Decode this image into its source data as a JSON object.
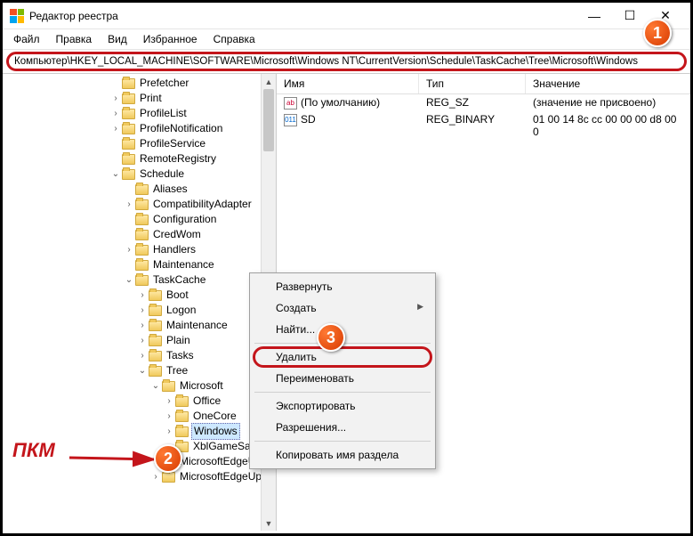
{
  "title": "Редактор реестра",
  "menu": {
    "file": "Файл",
    "edit": "Правка",
    "view": "Вид",
    "fav": "Избранное",
    "help": "Справка"
  },
  "address": "Компьютер\\HKEY_LOCAL_MACHINE\\SOFTWARE\\Microsoft\\Windows NT\\CurrentVersion\\Schedule\\TaskCache\\Tree\\Microsoft\\Windows",
  "tree": {
    "n0": "Prefetcher",
    "n1": "Print",
    "n2": "ProfileList",
    "n3": "ProfileNotification",
    "n4": "ProfileService",
    "n5": "RemoteRegistry",
    "schedule": "Schedule",
    "n6": "Aliases",
    "n7": "CompatibilityAdapter",
    "n8": "Configuration",
    "n9": "CredWom",
    "n10": "Handlers",
    "n11": "Maintenance",
    "taskcache": "TaskCache",
    "n12": "Boot",
    "n13": "Logon",
    "n14": "Maintenance",
    "n15": "Plain",
    "n16": "Tasks",
    "treek": "Tree",
    "ms": "Microsoft",
    "n17": "Office",
    "n18": "OneCore",
    "win": "Windows",
    "n19": "XblGameSave",
    "n20": "MicrosoftEdgeUp",
    "n21": "MicrosoftEdgeUp"
  },
  "cols": {
    "name": "Имя",
    "type": "Тип",
    "value": "Значение"
  },
  "rows": [
    {
      "icon": "ab",
      "name": "(По умолчанию)",
      "type": "REG_SZ",
      "value": "(значение не присвоено)"
    },
    {
      "icon": "bin",
      "name": "SD",
      "type": "REG_BINARY",
      "value": "01 00 14 8c cc 00 00 00 d8 00 0"
    }
  ],
  "ctx": {
    "expand": "Развернуть",
    "new": "Создать",
    "find": "Найти...",
    "delete": "Удалить",
    "rename": "Переименовать",
    "export": "Экспортировать",
    "perm": "Разрешения...",
    "copy": "Копировать имя раздела"
  },
  "annot": {
    "pkm": "ПКМ",
    "b1": "1",
    "b2": "2",
    "b3": "3"
  }
}
